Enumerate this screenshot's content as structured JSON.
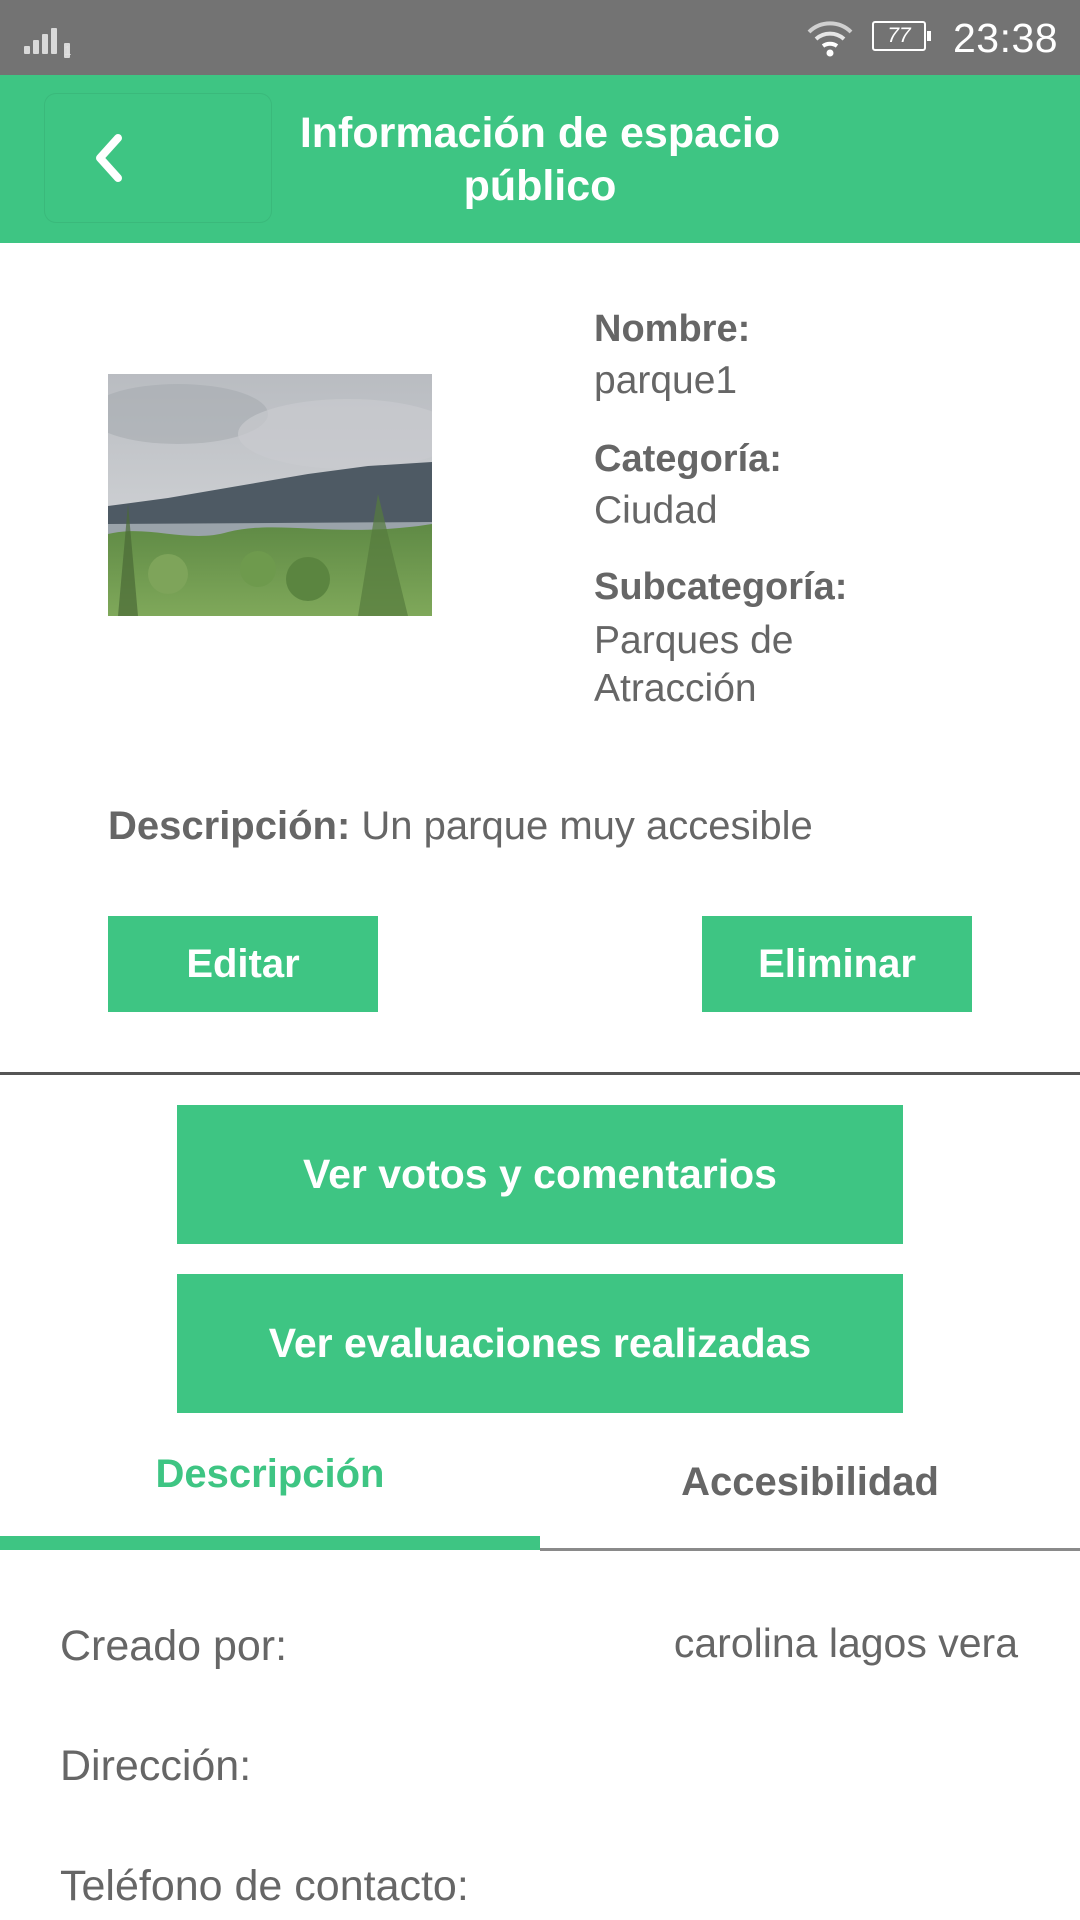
{
  "status_bar": {
    "time": "23:38",
    "battery": "77",
    "sim_slot": "1",
    "icons": [
      "signal-icon",
      "wifi-icon",
      "battery-icon"
    ]
  },
  "app_bar": {
    "title": "Información de espacio público",
    "back_icon": "chevron-left-icon",
    "color": "#3ec583"
  },
  "place": {
    "name_label": "Nombre:",
    "name": "parque1",
    "category_label": "Categoría:",
    "category": "Ciudad",
    "subcategory_label": "Subcategoría:",
    "subcategory": "Parques de Atracción",
    "description_label": "Descripción:",
    "description": " Un parque muy accesible"
  },
  "actions": {
    "edit": "Editar",
    "delete": "Eliminar",
    "votes_comments": "Ver votos y comentarios",
    "evaluations": "Ver evaluaciones realizadas"
  },
  "tabs": [
    {
      "label": "Descripción",
      "active": true
    },
    {
      "label": "Accesibilidad",
      "active": false
    }
  ],
  "details": [
    {
      "label": "Creado por:",
      "value": "carolina lagos vera"
    },
    {
      "label": "Dirección:",
      "value": ""
    },
    {
      "label": "Teléfono de contacto:",
      "value": ""
    }
  ],
  "colors": {
    "accent": "#3ec583",
    "status_bar": "#737373",
    "text": "#666666"
  }
}
